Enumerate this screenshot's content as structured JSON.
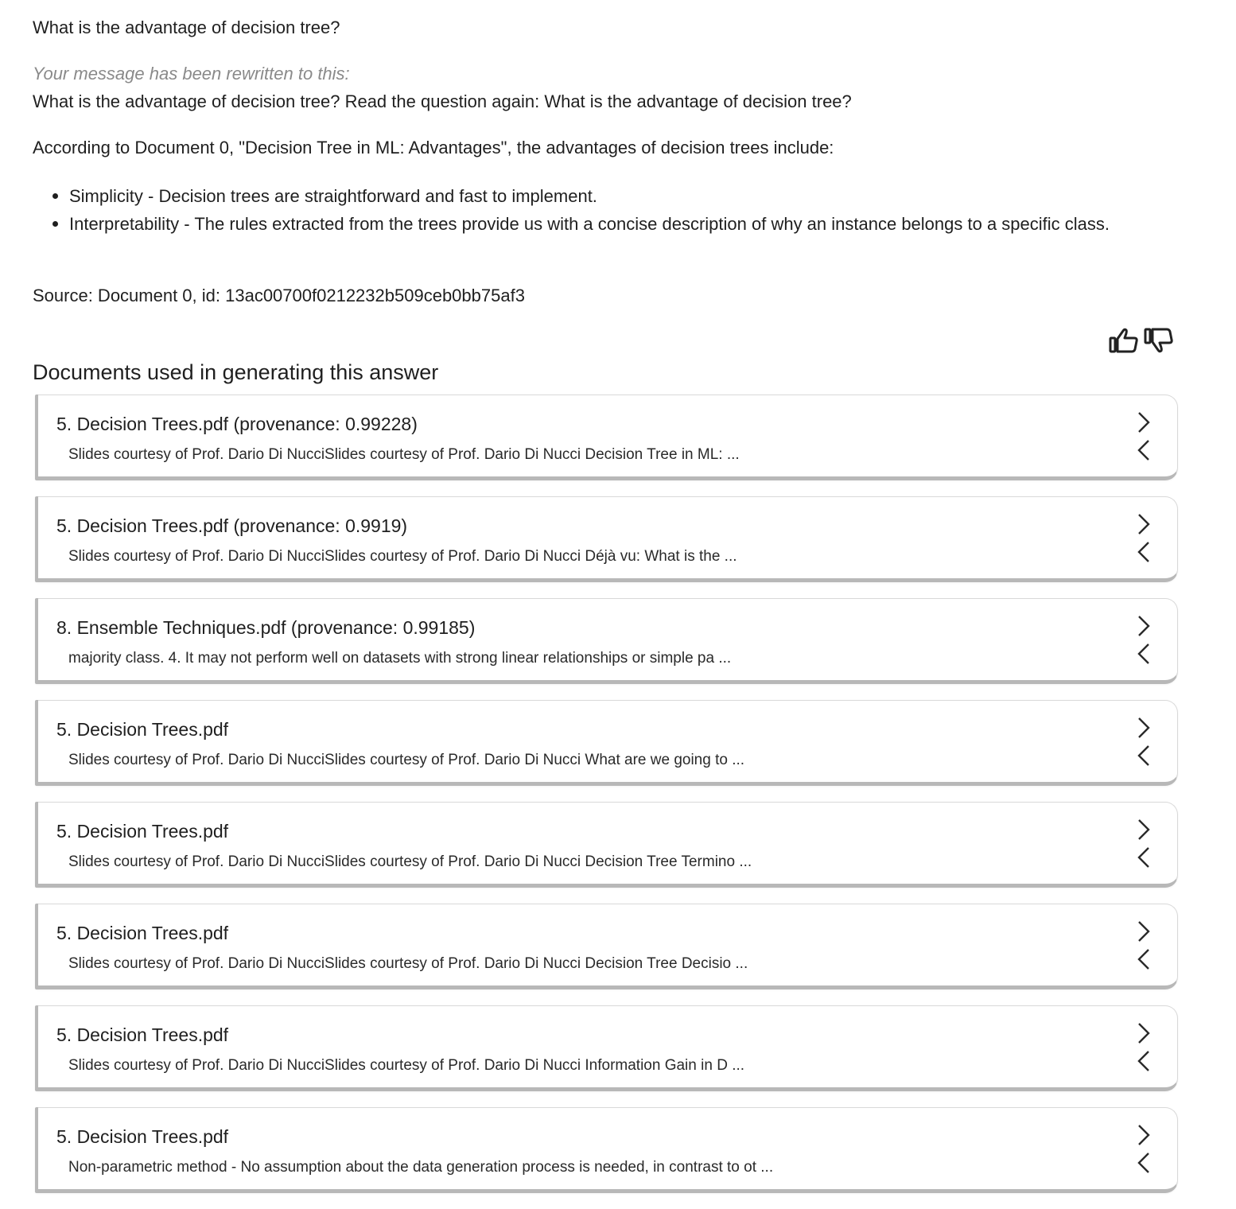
{
  "conversation": {
    "user_question": "What is the advantage of decision tree?",
    "rewrite_note": "Your message has been rewritten to this:",
    "rewritten_question": "What is the advantage of decision tree? Read the question again: What is the advantage of decision tree?",
    "answer_intro": "According to Document 0, \"Decision Tree in ML: Advantages\", the advantages of decision trees include:",
    "bullets": [
      "Simplicity - Decision trees are straightforward and fast to implement.",
      "Interpretability - The rules extracted from the trees provide us with a concise description of why an instance belongs to a specific class."
    ],
    "source": "Source: Document 0, id: 13ac00700f0212232b509ceb0bb75af3"
  },
  "feedback": {
    "thumbs_up_icon": "thumbs-up-icon",
    "thumbs_down_icon": "thumbs-down-icon"
  },
  "documents": {
    "heading": "Documents used in generating this answer",
    "items": [
      {
        "title": "5. Decision Trees.pdf (provenance: 0.99228)",
        "snippet": "Slides courtesy of Prof. Dario Di NucciSlides courtesy of Prof. Dario Di Nucci Decision Tree in ML: ..."
      },
      {
        "title": "5. Decision Trees.pdf (provenance: 0.9919)",
        "snippet": "Slides courtesy of Prof. Dario Di NucciSlides courtesy of Prof. Dario Di Nucci Déjà vu: What is the ..."
      },
      {
        "title": "8. Ensemble Techniques.pdf (provenance: 0.99185)",
        "snippet": "majority class. 4. It may not perform well on datasets with strong linear relationships or simple pa ..."
      },
      {
        "title": "5. Decision Trees.pdf",
        "snippet": "Slides courtesy of Prof. Dario Di NucciSlides courtesy of Prof. Dario Di Nucci What are we going to ..."
      },
      {
        "title": "5. Decision Trees.pdf",
        "snippet": "Slides courtesy of Prof. Dario Di NucciSlides courtesy of Prof. Dario Di Nucci Decision Tree Termino ..."
      },
      {
        "title": "5. Decision Trees.pdf",
        "snippet": "Slides courtesy of Prof. Dario Di NucciSlides courtesy of Prof. Dario Di Nucci Decision Tree Decisio ..."
      },
      {
        "title": "5. Decision Trees.pdf",
        "snippet": "Slides courtesy of Prof. Dario Di NucciSlides courtesy of Prof. Dario Di Nucci Information Gain in D ..."
      },
      {
        "title": "5. Decision Trees.pdf",
        "snippet": "Non-parametric method - No assumption about the data generation process is needed, in contrast to ot ..."
      }
    ],
    "toggle_icon": "expand-collapse-chevrons-icon"
  }
}
